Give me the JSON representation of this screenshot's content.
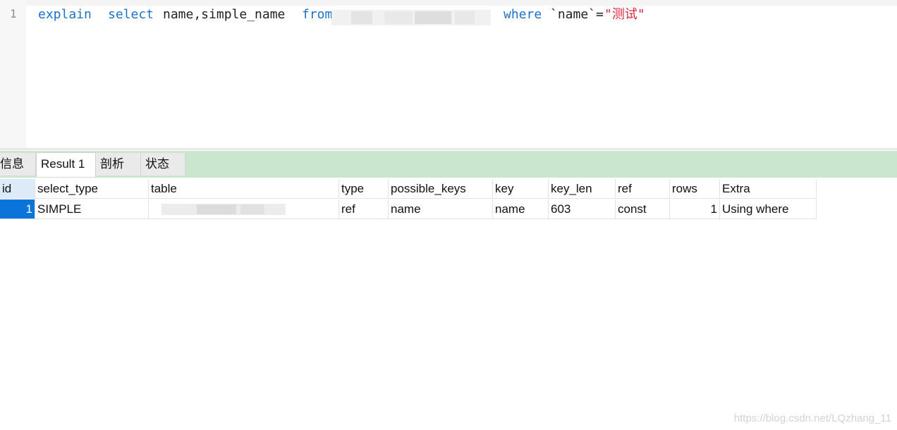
{
  "editor": {
    "line_number": "1",
    "tokens": {
      "explain": "explain",
      "select": "select",
      "columns": "name,simple_name",
      "from": "from",
      "where": "where",
      "condition": "`name`=",
      "value": "\"测试\""
    }
  },
  "tabs": [
    {
      "label": "信息"
    },
    {
      "label": "Result 1"
    },
    {
      "label": "剖析"
    },
    {
      "label": "状态"
    }
  ],
  "result": {
    "columns": [
      "id",
      "select_type",
      "table",
      "type",
      "possible_keys",
      "key",
      "key_len",
      "ref",
      "rows",
      "Extra"
    ],
    "rows": [
      [
        "1",
        "SIMPLE",
        "",
        "ref",
        "name",
        "name",
        "603",
        "const",
        "1",
        "Using where"
      ]
    ]
  },
  "watermark": "https://blog.csdn.net/LQzhang_11"
}
